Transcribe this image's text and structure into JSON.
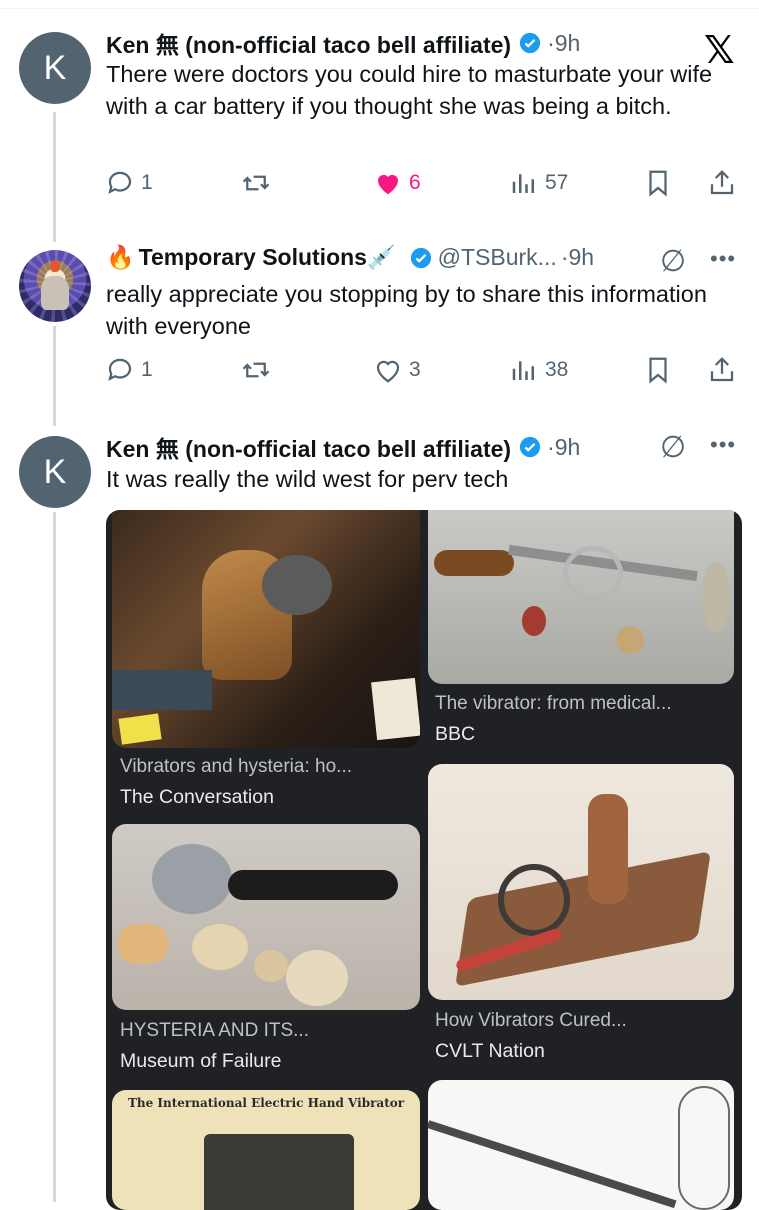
{
  "tweets": [
    {
      "avatar_letter": "K",
      "name": "Ken 無 (non-official taco bell affiliate)",
      "time": "9h",
      "text": "There were doctors you could hire to masturbate your wife with a car battery if you thought she was being a bitch.",
      "replies": "1",
      "likes": "6",
      "views": "57"
    },
    {
      "name": "Temporary Solutions",
      "emoji_prefix": "🔥",
      "emoji_suffix": "💉",
      "handle": "@TSBurk...",
      "time": "9h",
      "text": "really appreciate you stopping by to share this information with everyone",
      "replies": "1",
      "likes": "3",
      "views": "38"
    },
    {
      "avatar_letter": "K",
      "name": "Ken 無 (non-official taco bell affiliate)",
      "time": "9h",
      "text": "It was really the wild west for perv tech"
    }
  ],
  "separator": "·",
  "results": [
    {
      "title": "Vibrators and hysteria: ho...",
      "source": "The Conversation"
    },
    {
      "title": "The vibrator: from medical...",
      "source": "BBC"
    },
    {
      "title": "HYSTERIA AND ITS...",
      "source": "Museum of Failure"
    },
    {
      "title": "How Vibrators Cured...",
      "source": "CVLT Nation"
    }
  ],
  "poster_text": "The International Electric Hand Vibrator",
  "icons": {
    "app_logo": "x-logo-icon",
    "reply": "reply-icon",
    "retweet": "retweet-icon",
    "like": "heart-icon",
    "views": "views-icon",
    "bookmark": "bookmark-icon",
    "share": "share-icon"
  },
  "colors": {
    "verified": "#1d9bf0",
    "liked": "#f91880",
    "muted": "#536471"
  }
}
